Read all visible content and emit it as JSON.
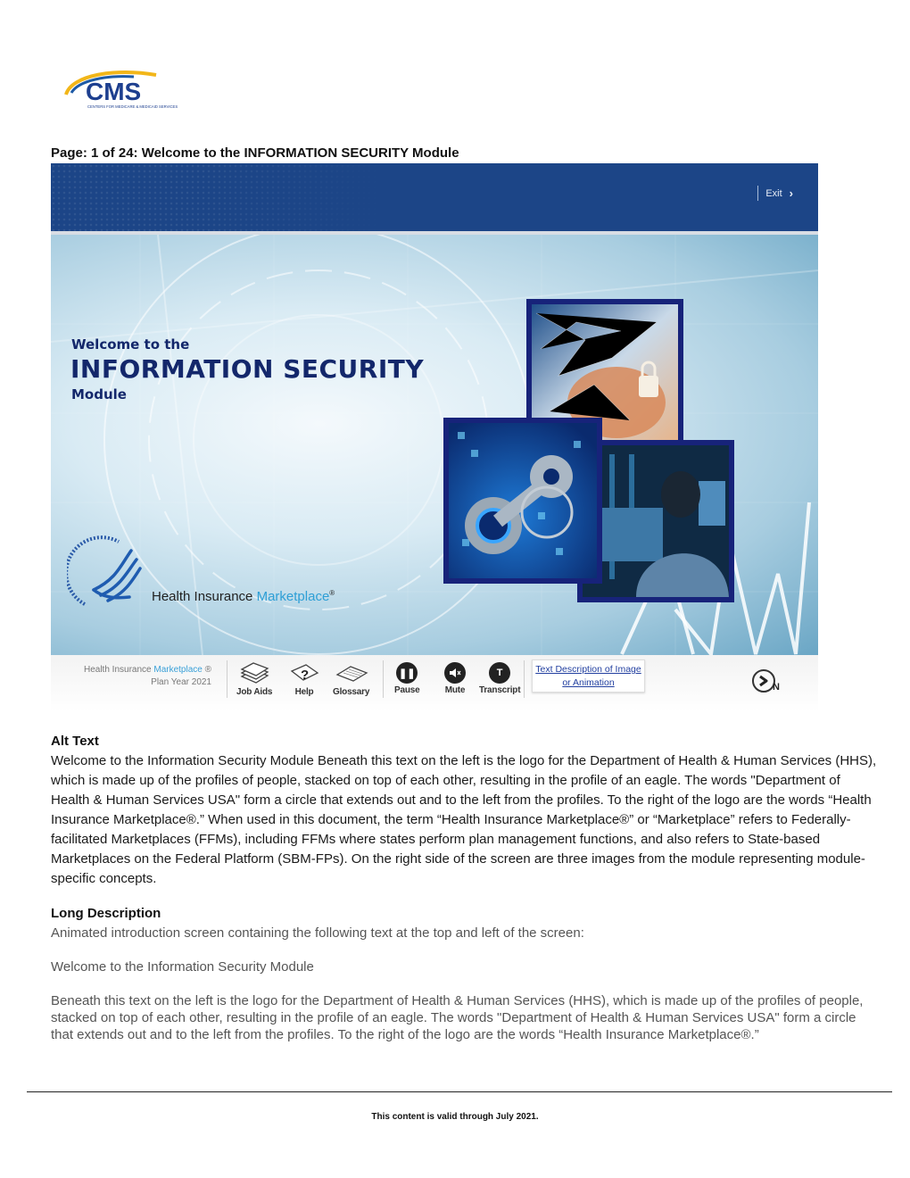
{
  "header": {
    "logo_text": "CMS",
    "logo_subtext": "CENTERS FOR MEDICARE & MEDICAID SERVICES",
    "page_heading": "Page: 1 of 24: Welcome to the INFORMATION SECURITY Module"
  },
  "screen": {
    "exit_label": "Exit",
    "title_line1": "Welcome to the",
    "title_line2": "INFORMATION SECURITY",
    "title_line3": "Module",
    "brand_prefix": "Health Insurance ",
    "brand_accent": "Marketplace",
    "brand_mark": "®",
    "photos": [
      {
        "name": "hand-with-padlock"
      },
      {
        "name": "key-in-lock"
      },
      {
        "name": "analyst-at-monitors"
      }
    ],
    "toolbar": {
      "plan_brand_prefix": "Health Insurance ",
      "plan_brand_accent": "Marketplace",
      "plan_brand_mark": " ®",
      "plan_year": "Plan Year 2021",
      "job_aids": "Job Aids",
      "help": "Help",
      "glossary": "Glossary",
      "pause": "Pause",
      "mute": "Mute",
      "transcript": "Transcript",
      "transcript_glyph": "T",
      "text_description_line1": "Text Description of Image",
      "text_description_line2": "or Animation",
      "next_glyph": "N"
    },
    "colors": {
      "topbar": "#1c4587",
      "title": "#13276b",
      "photo_border": "#17237a",
      "accent": "#2e9fd6"
    }
  },
  "alt_text": {
    "heading": "Alt Text",
    "body": "Welcome to the Information Security Module Beneath this text on the left is the logo for the Department of Health & Human Services (HHS), which is made up of the profiles of people, stacked on top of each other, resulting in the profile of an eagle. The words \"Department of Health & Human Services USA\" form a circle that extends out and to the left from the profiles. To the right of the logo are the words “Health Insurance Marketplace®.” When used in this document, the term “Health Insurance Marketplace®” or “Marketplace” refers to Federally-facilitated Marketplaces (FFMs), including FFMs where states perform plan management functions, and also refers to State-based Marketplaces on the Federal Platform (SBM-FPs). On the right side of the screen are three images from the module representing module-specific concepts."
  },
  "long_description": {
    "heading": "Long Description",
    "intro": "Animated introduction screen containing the following text at the top and left of the screen:",
    "quote": "Welcome to the Information Security Module",
    "body": "Beneath this text on the left is the logo for the Department of Health & Human Services (HHS), which is made up of the profiles of people, stacked on top of each other, resulting in the profile of an eagle. The words \"Department of Health & Human Services USA\" form a circle that extends out and to the left from the profiles. To the right of the logo are the words “Health Insurance Marketplace®.”"
  },
  "footer": {
    "validity": "This content is valid through July 2021."
  }
}
